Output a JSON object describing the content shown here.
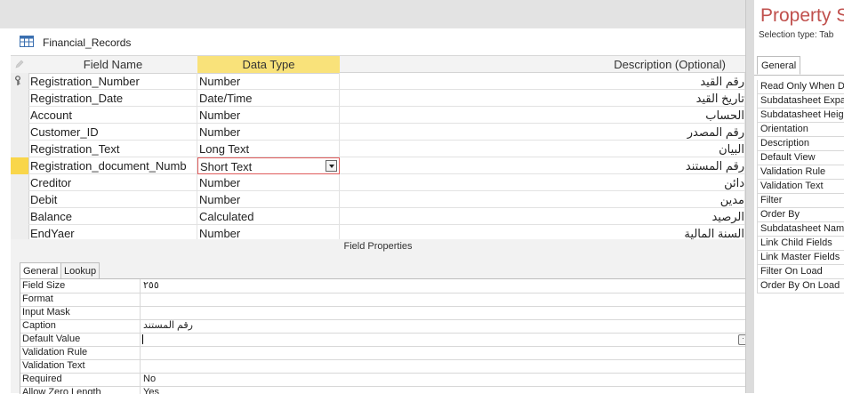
{
  "document": {
    "title": "Financial_Records"
  },
  "grid": {
    "headers": {
      "field_name": "Field Name",
      "data_type": "Data Type",
      "description": "Description (Optional)"
    },
    "rows": [
      {
        "field": "Registration_Number",
        "type": "Number",
        "desc": "رقم القيد"
      },
      {
        "field": "Registration_Date",
        "type": "Date/Time",
        "desc": "تاريخ القيد"
      },
      {
        "field": "Account",
        "type": "Number",
        "desc": "الحساب"
      },
      {
        "field": "Customer_ID",
        "type": "Number",
        "desc": "رقم المصدر"
      },
      {
        "field": "Registration_Text",
        "type": "Long Text",
        "desc": "البيان"
      },
      {
        "field": "Registration_document_Numb",
        "type": "Short Text",
        "desc": "رقم المستند"
      },
      {
        "field": "Creditor",
        "type": "Number",
        "desc": "دائن"
      },
      {
        "field": "Debit",
        "type": "Number",
        "desc": "مدين"
      },
      {
        "field": "Balance",
        "type": "Calculated",
        "desc": "الرصيد"
      },
      {
        "field": "EndYaer",
        "type": "Number",
        "desc": "السنة المالية"
      }
    ]
  },
  "field_properties": {
    "title": "Field Properties",
    "tabs": [
      "General",
      "Lookup"
    ],
    "rows": [
      {
        "label": "Field Size",
        "value": "٢٥٥"
      },
      {
        "label": "Format",
        "value": ""
      },
      {
        "label": "Input Mask",
        "value": ""
      },
      {
        "label": "Caption",
        "value": "رقم المستند"
      },
      {
        "label": "Default Value",
        "value": ""
      },
      {
        "label": "Validation Rule",
        "value": ""
      },
      {
        "label": "Validation Text",
        "value": ""
      },
      {
        "label": "Required",
        "value": "No"
      },
      {
        "label": "Allow Zero Length",
        "value": "Yes"
      }
    ]
  },
  "property_sheet": {
    "title": "Property S",
    "selection_type": "Selection type:  Tab",
    "tab": "General",
    "items": [
      "Read Only When D",
      "Subdatasheet Expa",
      "Subdatasheet Heig",
      "Orientation",
      "Description",
      "Default View",
      "Validation Rule",
      "Validation Text",
      "Filter",
      "Order By",
      "Subdatasheet Nam",
      "Link Child Fields",
      "Link Master Fields",
      "Filter On Load",
      "Order By On Load"
    ]
  },
  "colors": {
    "selected_header": "#f9e27a",
    "active_selector": "#f9d64a",
    "accent_title": "#c0504d",
    "active_cell_border": "#e05b5b"
  }
}
